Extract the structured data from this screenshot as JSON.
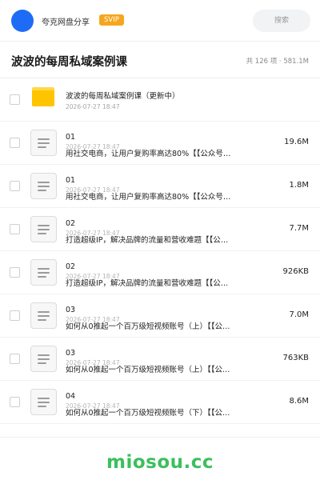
{
  "header": {
    "app_name": "夸克网盘分享",
    "badge": "SVIP",
    "search_placeholder": "搜索",
    "avatar_color": "#1e6cf5",
    "badge_color": "#f6a61e"
  },
  "folder": {
    "title": "波波的每周私域案例课",
    "summary": "共 126 项 · 581.1M"
  },
  "items": [
    {
      "type": "folder",
      "icon": "folder-icon",
      "name": "波波的每周私域案例课（更新中）",
      "date": "2026-07-27 18:47"
    },
    {
      "type": "file",
      "icon": "document-icon",
      "number": "01",
      "date": "2026-07-27 18:47",
      "name": "用社交电商，让用户复购率高达80%【【公众号…",
      "size": "19.6M"
    },
    {
      "type": "file",
      "icon": "document-icon",
      "number": "01",
      "date": "2026-07-27 18:47",
      "name": "用社交电商，让用户复购率高达80%【【公众号…",
      "size": "1.8M"
    },
    {
      "type": "file",
      "icon": "document-icon",
      "number": "02",
      "date": "2026-07-27 18:47",
      "name": "打造超级IP，解决品牌的流量和营收难题【【公…",
      "size": "7.7M"
    },
    {
      "type": "file",
      "icon": "document-icon",
      "number": "02",
      "date": "2026-07-27 18:47",
      "name": "打造超级IP，解决品牌的流量和营收难题【【公…",
      "size": "926KB"
    },
    {
      "type": "file",
      "icon": "document-icon",
      "number": "03",
      "date": "2026-07-27 18:47",
      "name": "如何从0推起一个百万级短视频账号（上）【【公…",
      "size": "7.0M"
    },
    {
      "type": "file",
      "icon": "document-icon",
      "number": "03",
      "date": "2026-07-27 18:47",
      "name": "如何从0推起一个百万级短视频账号（上）【【公…",
      "size": "763KB"
    },
    {
      "type": "file",
      "icon": "document-icon",
      "number": "04",
      "date": "2026-07-27 18:47",
      "name": "如何从0推起一个百万级短视频账号（下）【【公…",
      "size": "8.6M"
    }
  ],
  "watermark": "miosou.cc"
}
